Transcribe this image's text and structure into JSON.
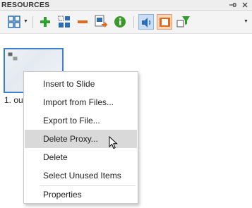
{
  "panel": {
    "title": "RESOURCES",
    "pin_icon": "pin-icon",
    "close_icon": "close-icon"
  },
  "toolbar": {
    "buttons": [
      {
        "name": "view-layout-button",
        "icon": "grid-view-icon"
      },
      {
        "name": "add-button",
        "icon": "plus-icon",
        "color": "#2e9e2e"
      },
      {
        "name": "insert-button",
        "icon": "blocks-icon"
      },
      {
        "name": "remove-button",
        "icon": "minus-icon",
        "color": "#e06a1a"
      },
      {
        "name": "export-button",
        "icon": "export-icon"
      },
      {
        "name": "info-button",
        "icon": "info-icon",
        "color": "#3a9a2a"
      },
      {
        "name": "audio-filter-button",
        "icon": "speaker-icon",
        "active": true
      },
      {
        "name": "video-filter-button",
        "icon": "film-icon",
        "pressed": true
      },
      {
        "name": "filter-button",
        "icon": "funnel-icon"
      }
    ],
    "overflow_icon": "chevron-down-icon"
  },
  "thumbnail": {
    "caption": "1. ou"
  },
  "context_menu": {
    "items": [
      {
        "label": "Insert to Slide"
      },
      {
        "label": "Import from Files..."
      },
      {
        "label": "Export to File..."
      },
      {
        "label": "Delete Proxy...",
        "hovered": true
      },
      {
        "label": "Delete"
      },
      {
        "label": "Select Unused Items"
      },
      {
        "label": "Properties"
      }
    ]
  },
  "colors": {
    "selection_border": "#3c7fd1",
    "hover_background": "#d9d9d9",
    "accent_orange": "#e06a1a",
    "accent_green": "#2e9e2e"
  }
}
